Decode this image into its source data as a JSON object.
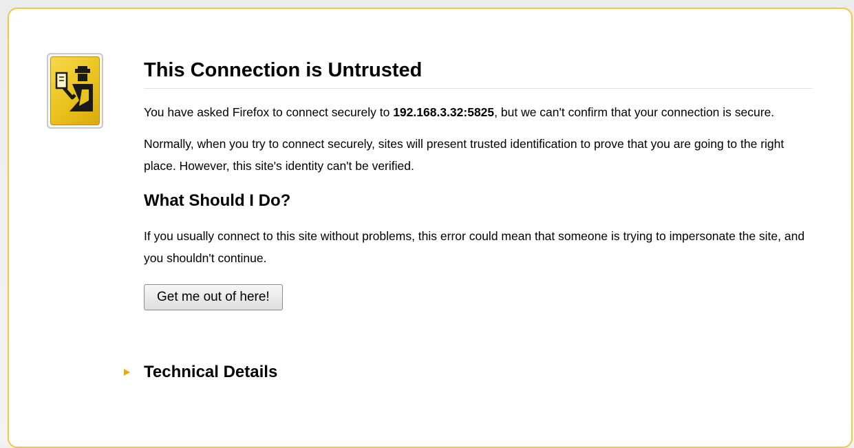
{
  "error": {
    "title": "This Connection is Untrusted",
    "intro_before_host": "You have asked Firefox to connect securely to ",
    "host": "192.168.3.32:5825",
    "intro_after_host": ", but we can't confirm that your connection is secure.",
    "paragraph2": "Normally, when you try to connect securely, sites will present trusted identification to prove that you are going to the right place. However, this site's identity can't be verified.",
    "subtitle": "What Should I Do?",
    "paragraph3": "If you usually connect to this site without problems, this error could mean that someone is trying to impersonate the site, and you shouldn't continue.",
    "button_label": "Get me out of here!",
    "technical_details_label": "Technical Details"
  },
  "icons": {
    "certificate": "certificate-officer-icon",
    "expand": "expand-triangle-icon"
  },
  "colors": {
    "frame_border": "#f5c542",
    "icon_yellow": "#eac21c",
    "arrow": "#f0a800"
  }
}
